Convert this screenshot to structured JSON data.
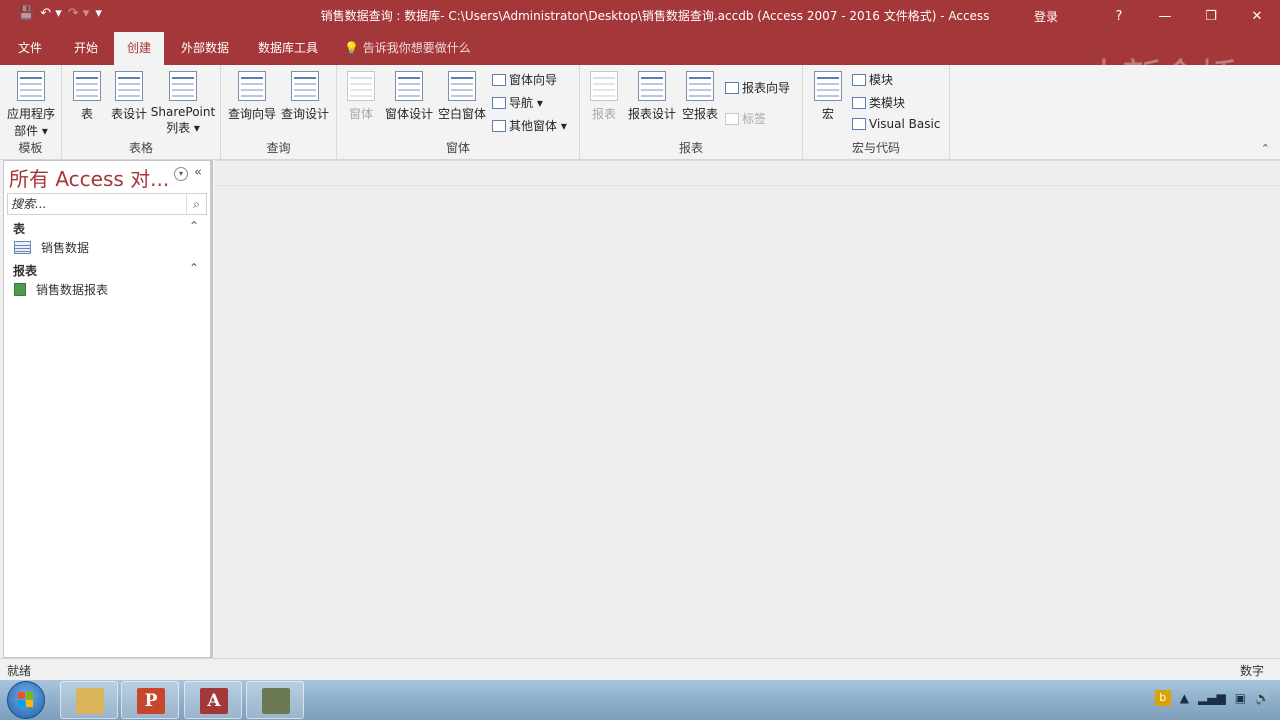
{
  "titlebar": {
    "title": "销售数据查询 : 数据库- C:\\Users\\Administrator\\Desktop\\销售数据查询.accdb (Access 2007 - 2016 文件格式)  -  Access",
    "signin": "登录",
    "help": "?",
    "minimize": "—",
    "restore": "❐",
    "close": "✕",
    "qat": {
      "save": "💾",
      "undo": "↶ ▾",
      "redo": "↷ ▾",
      "customize": "▾"
    }
  },
  "tabs": [
    {
      "label": "文件"
    },
    {
      "label": "开始"
    },
    {
      "label": "创建"
    },
    {
      "label": "外部数据"
    },
    {
      "label": "数据库工具"
    }
  ],
  "tellme": "💡 告诉我你想要做什么",
  "watermark": "中新金桥",
  "ribbon": {
    "templates": {
      "label": "模板",
      "app_parts_1": "应用程序",
      "app_parts_2": "部件 ▾"
    },
    "tables": {
      "label": "表格",
      "table": "表",
      "table_design": "表设计",
      "sharepoint_1": "SharePoint",
      "sharepoint_2": "列表 ▾"
    },
    "queries": {
      "label": "查询",
      "query_wizard": "查询向导",
      "query_design": "查询设计"
    },
    "forms": {
      "label": "窗体",
      "form": "窗体",
      "form_design": "窗体设计",
      "blank_form": "空白窗体",
      "form_wizard": "窗体向导",
      "navigation": "导航 ▾",
      "more_forms": "其他窗体 ▾"
    },
    "reports": {
      "label": "报表",
      "report": "报表",
      "report_design": "报表设计",
      "blank_report": "空报表",
      "report_wizard": "报表向导",
      "labels": "标签"
    },
    "macros": {
      "label": "宏与代码",
      "macro": "宏",
      "module": "模块",
      "class_module": "类模块",
      "visual_basic": "Visual Basic"
    },
    "collapse": "⌃"
  },
  "navpane": {
    "title": "所有 Access 对...",
    "dropdown": "▾",
    "shutter": "«",
    "search_placeholder": "搜索...",
    "search_icon": "⌕",
    "sections": [
      {
        "header": "表",
        "collapse": "⌃",
        "items": [
          {
            "label": "销售数据",
            "icon": "table-icon"
          }
        ]
      },
      {
        "header": "报表",
        "collapse": "⌃",
        "items": [
          {
            "label": "销售数据报表",
            "icon": "report-icon"
          }
        ]
      }
    ]
  },
  "statusbar": {
    "left": "就绪",
    "right": "数字"
  },
  "taskbar": {
    "apps": [
      {
        "name": "file-explorer",
        "letter": "",
        "color": "#d9b45a"
      },
      {
        "name": "powerpoint",
        "letter": "P",
        "color": "#c8472c"
      },
      {
        "name": "access",
        "letter": "A",
        "color": "#a4373a"
      },
      {
        "name": "other-app",
        "letter": "",
        "color": "#6b7a55"
      }
    ],
    "tray_arrow": "▲",
    "tray_icons": [
      "signal-icon",
      "device-icon",
      "volume-icon"
    ]
  }
}
